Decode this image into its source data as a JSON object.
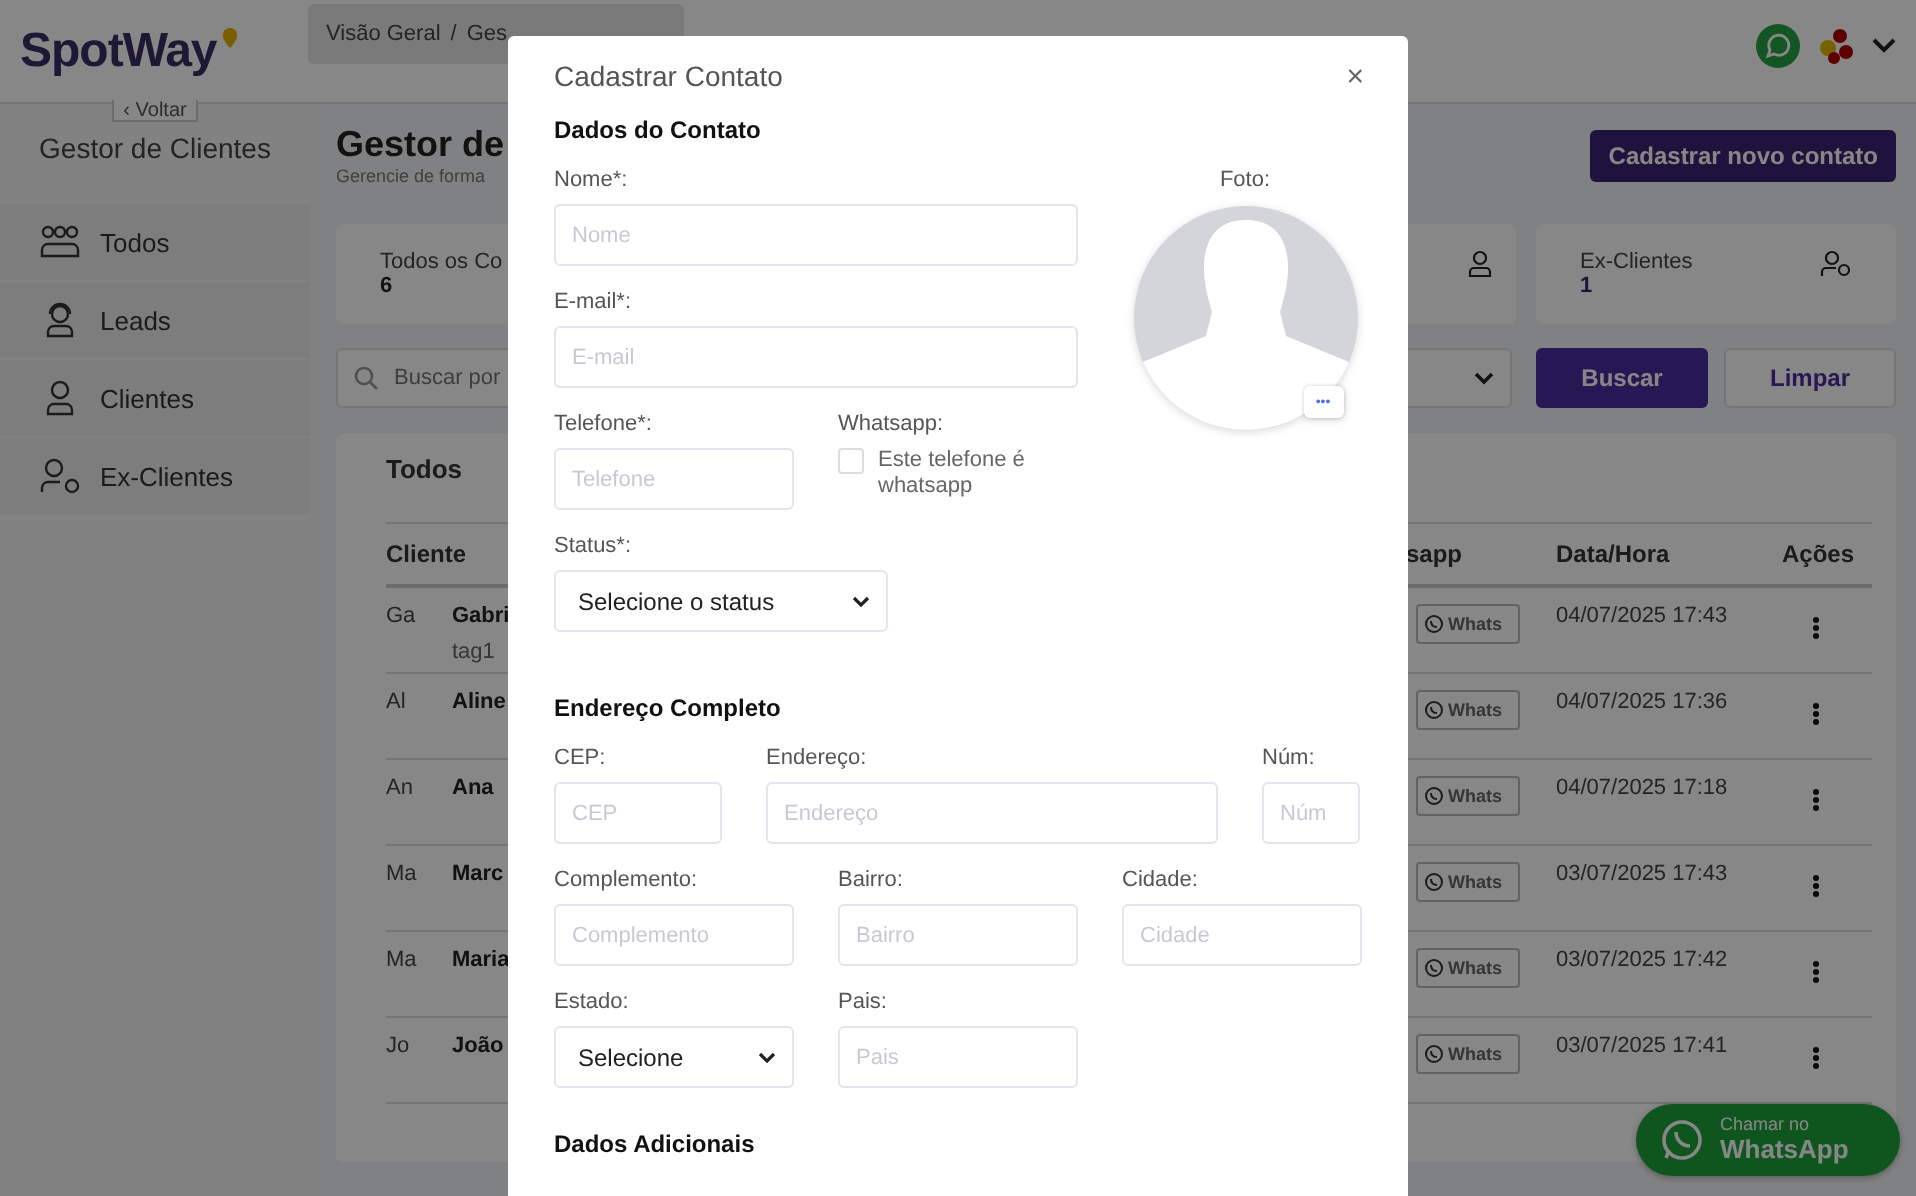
{
  "header": {
    "logo": "SpotWay",
    "breadcrumb": [
      "Visão Geral",
      "/",
      "Ges"
    ]
  },
  "sidebar": {
    "back_button": "‹ Voltar",
    "title": "Gestor de Clientes",
    "items": [
      {
        "kind": "group",
        "label": "Todos"
      },
      {
        "kind": "headset",
        "label": "Leads"
      },
      {
        "kind": "person",
        "label": "Clientes"
      },
      {
        "kind": "person-tag",
        "label": "Ex-Clientes"
      }
    ]
  },
  "main": {
    "title": "Gestor de",
    "subtitle": "Gerencie de forma",
    "new_contact_button": "Cadastrar novo contato",
    "stats": [
      {
        "label": "Todos os Co",
        "value": "6"
      },
      {
        "label": "Ex-Clientes",
        "value": "1"
      }
    ],
    "filters": {
      "search_placeholder": "Buscar por",
      "search_button": "Buscar",
      "clear_button": "Limpar"
    },
    "table": {
      "title": "Todos",
      "columns": [
        "Cliente",
        "sapp",
        "Data/Hora",
        "Ações"
      ],
      "rows": [
        {
          "initials": "Ga",
          "name": "Gabri",
          "tag": "tag1",
          "whats": "Whats",
          "datetime": "04/07/2025 17:43"
        },
        {
          "initials": "Al",
          "name": "Aline",
          "whats": "Whats",
          "datetime": "04/07/2025 17:36"
        },
        {
          "initials": "An",
          "name": "Ana",
          "whats": "Whats",
          "datetime": "04/07/2025 17:18"
        },
        {
          "initials": "Ma",
          "name": "Marc",
          "whats": "Whats",
          "datetime": "03/07/2025 17:43"
        },
        {
          "initials": "Ma",
          "name": "Maria",
          "whats": "Whats",
          "datetime": "03/07/2025 17:42"
        },
        {
          "initials": "Jo",
          "name": "João",
          "whats": "Whats",
          "datetime": "03/07/2025 17:41"
        }
      ]
    },
    "whatsapp_float": {
      "line1": "Chamar no",
      "line2": "WhatsApp"
    }
  },
  "modal": {
    "title": "Cadastrar Contato",
    "close": "×",
    "contact_section": "Dados do Contato",
    "name": {
      "label": "Nome*:",
      "placeholder": "Nome"
    },
    "email": {
      "label": "E-mail*:",
      "placeholder": "E-mail"
    },
    "phone": {
      "label": "Telefone*:",
      "placeholder": "Telefone"
    },
    "whatsapp": {
      "label": "Whatsapp:",
      "checkbox_label": "Este telefone é whatsapp",
      "checked": false
    },
    "photo": {
      "label": "Foto:",
      "menu": "•••"
    },
    "status": {
      "label": "Status*:",
      "value": "Selecione o status"
    },
    "address_section": "Endereço Completo",
    "cep": {
      "label": "CEP:",
      "placeholder": "CEP"
    },
    "street": {
      "label": "Endereço:",
      "placeholder": "Endereço"
    },
    "number": {
      "label": "Núm:",
      "placeholder": "Núm"
    },
    "complement": {
      "label": "Complemento:",
      "placeholder": "Complemento"
    },
    "district": {
      "label": "Bairro:",
      "placeholder": "Bairro"
    },
    "city": {
      "label": "Cidade:",
      "placeholder": "Cidade"
    },
    "state": {
      "label": "Estado:",
      "value": "Selecione"
    },
    "country": {
      "label": "Pais:",
      "placeholder": "Pais"
    },
    "extra_section": "Dados Adicionais"
  }
}
